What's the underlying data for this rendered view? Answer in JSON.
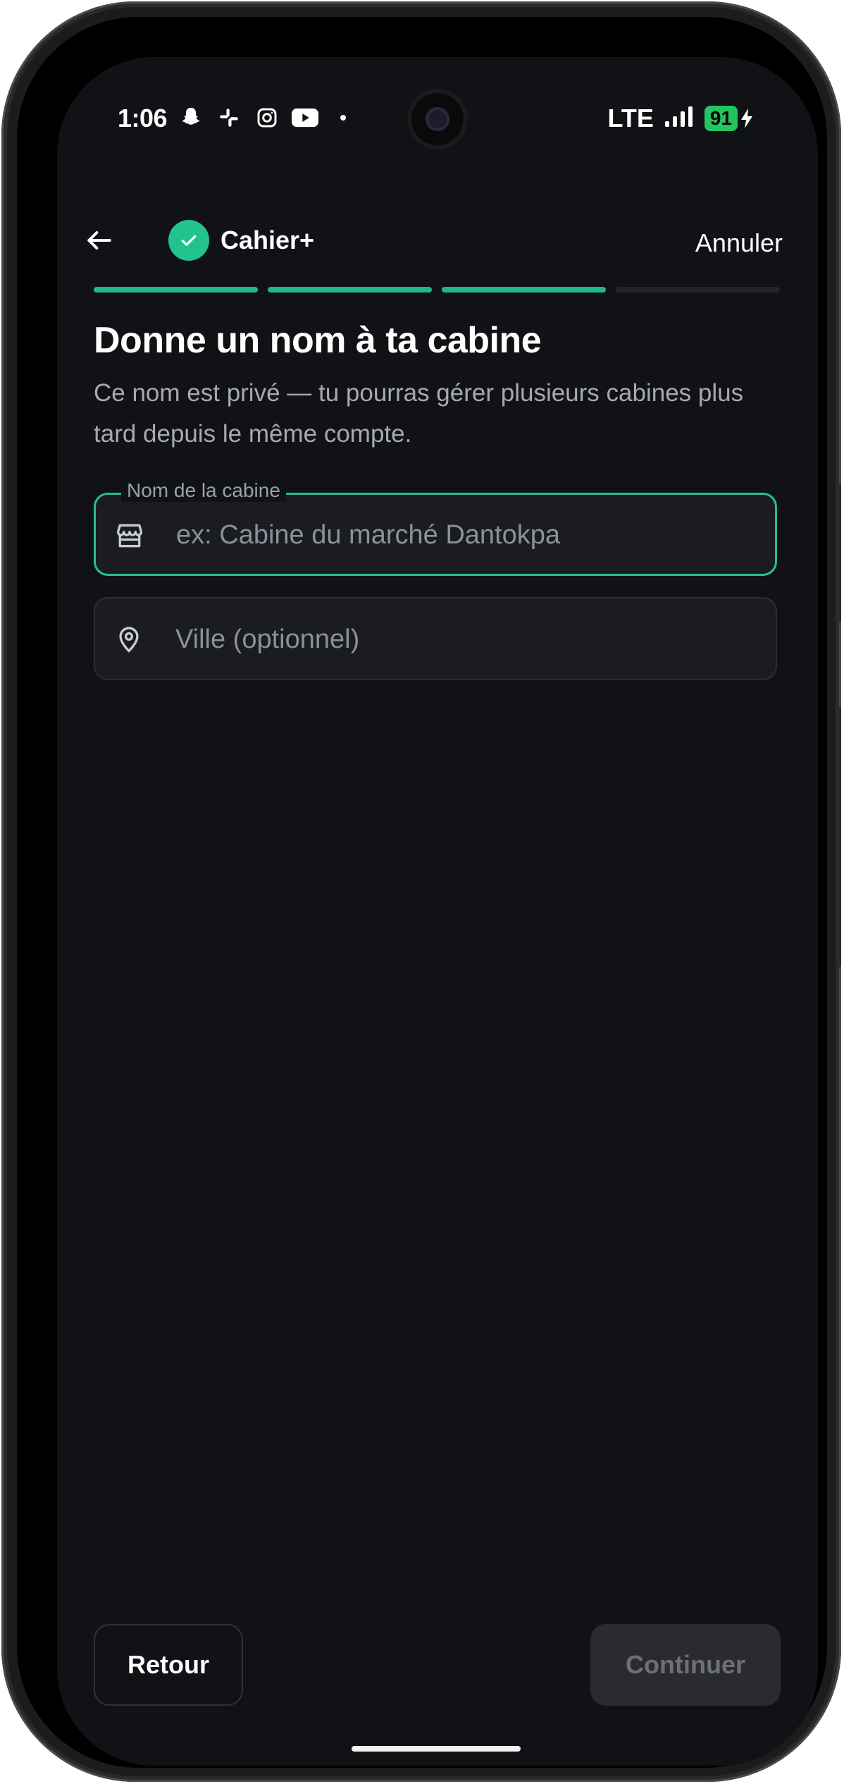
{
  "status_bar": {
    "time": "1:06",
    "network": "LTE",
    "battery": "91",
    "notification_icons": [
      "snapchat-icon",
      "slack-icon",
      "instagram-icon",
      "youtube-icon",
      "dot-icon"
    ]
  },
  "header": {
    "brand": "Cahier+",
    "cancel_label": "Annuler"
  },
  "progress": {
    "total_steps": 4,
    "completed_steps": 3,
    "accent": "#20b887"
  },
  "content": {
    "title": "Donne un nom à ta cabine",
    "subtitle": "Ce nom est privé — tu pourras gérer plusieurs cabines plus tard depuis le même compte.",
    "fields": [
      {
        "label": "Nom de la cabine",
        "placeholder": "ex: Cabine du marché Dantokpa",
        "value": "",
        "icon": "store-icon"
      },
      {
        "label": "",
        "placeholder": "Ville (optionnel)",
        "value": "",
        "icon": "location-pin-icon"
      }
    ]
  },
  "footer": {
    "back_label": "Retour",
    "continue_label": "Continuer"
  },
  "colors": {
    "background": "#111216",
    "accent": "#22c38e",
    "field_bg": "#1a1c21"
  }
}
